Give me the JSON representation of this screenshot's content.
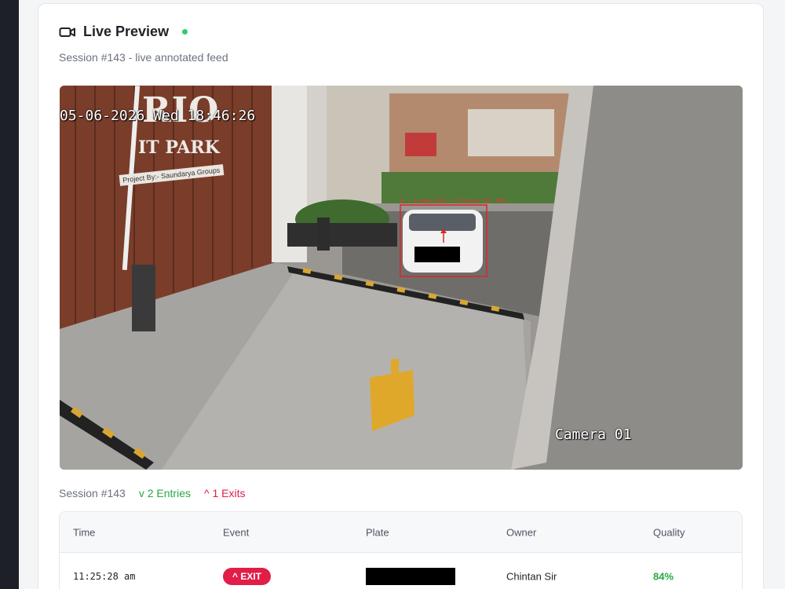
{
  "header": {
    "title": "Live Preview",
    "subtitle": "Session #143 - live annotated feed"
  },
  "video": {
    "timestamp_overlay": "05-06-2026 Wed 18:46:26",
    "camera_label": "Camera 01",
    "signage_line1": "RIO",
    "signage_line2": "IT PARK",
    "signage_line3": "Project By:- Saundarya Groups",
    "detection_label": "0 • [redacted] • Chintan Sir 84%"
  },
  "stats": {
    "session": "Session #143",
    "entries": "v 2 Entries",
    "exits": "^ 1 Exits"
  },
  "table": {
    "columns": [
      "Time",
      "Event",
      "Plate",
      "Owner",
      "Quality"
    ],
    "rows": [
      {
        "time": "11:25:28 am",
        "event": "^ EXIT",
        "plate": "",
        "owner": "Chintan Sir",
        "quality": "84%"
      }
    ]
  },
  "colors": {
    "live_dot": "#2ecc71",
    "entries": "#27a844",
    "exits": "#e11d48",
    "quality": "#27a844"
  },
  "icons": [
    "video-camera-icon"
  ]
}
